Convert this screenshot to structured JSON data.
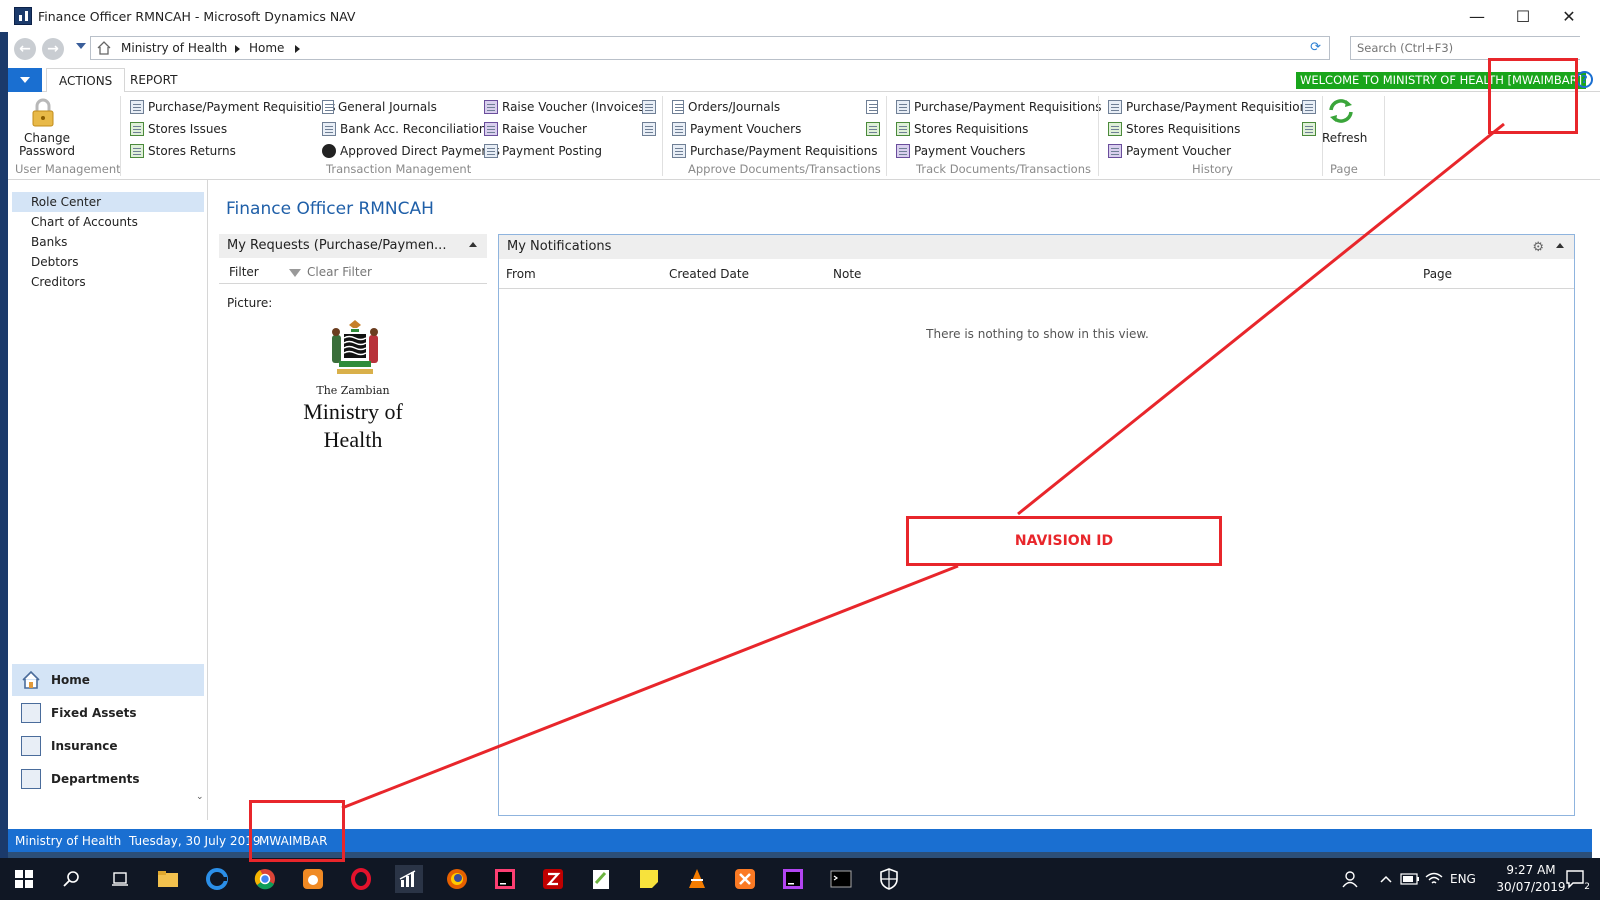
{
  "window": {
    "title": "Finance Officer RMNCAH - Microsoft Dynamics NAV",
    "minimize": "—",
    "maximize": "☐",
    "close": "✕"
  },
  "address": {
    "crumbs": [
      "Ministry of Health",
      "Home"
    ],
    "search_placeholder": "Search (Ctrl+F3)"
  },
  "ribbon_tabs": {
    "actions": "ACTIONS",
    "report": "REPORT",
    "welcome": "WELCOME TO MINISTRY OF HEALTH [MWAIMBAR]",
    "help": "?"
  },
  "ribbon": {
    "user_management": {
      "label": "User Management",
      "change_password": "Change Password"
    },
    "transaction_management": {
      "label": "Transaction Management",
      "col1": [
        "Purchase/Payment Requisitions",
        "Stores Issues",
        "Stores Returns"
      ],
      "col2": [
        "General Journals",
        "Bank Acc. Reconciliations",
        "Approved Direct Payments"
      ],
      "col3": [
        "Raise Voucher (Invoices)",
        "Raise Voucher",
        "Payment Posting"
      ]
    },
    "approve": {
      "label": "Approve Documents/Transactions",
      "items": [
        "Orders/Journals",
        "Payment Vouchers",
        "Purchase/Payment Requisitions"
      ]
    },
    "track": {
      "label": "Track  Documents/Transactions",
      "items": [
        "Purchase/Payment Requisitions",
        "Stores Requisitions",
        "Payment Vouchers"
      ]
    },
    "history": {
      "label": "History",
      "items": [
        "Purchase/Payment Requisitions",
        "Stores Requisitions",
        "Payment Voucher"
      ]
    },
    "page": {
      "label": "Page",
      "refresh": "Refresh"
    }
  },
  "navigation": {
    "items": [
      "Role Center",
      "Chart of Accounts",
      "Banks",
      "Debtors",
      "Creditors"
    ],
    "selected": "Role Center",
    "departments": [
      "Home",
      "Fixed Assets",
      "Insurance",
      "Departments"
    ],
    "more": "⌄"
  },
  "main": {
    "page_title": "Finance Officer RMNCAH",
    "requests": {
      "title": "My Requests (Purchase/Paymen...",
      "filter": "Filter",
      "clear_filter": "Clear Filter",
      "picture_label": "Picture:",
      "logo_line1": "The Zambian",
      "logo_line2": "Ministry of",
      "logo_line3": "Health"
    },
    "notifications": {
      "title": "My Notifications",
      "columns": [
        "From",
        "Created Date",
        "Note",
        "Page"
      ],
      "empty": "There is nothing to show in this view."
    }
  },
  "status_bar": {
    "company": "Ministry of Health",
    "date": "Tuesday, 30 July 2019",
    "user": "MWAIMBAR"
  },
  "annotation": {
    "label": "NAVISION ID",
    "color": "#e8262b"
  },
  "taskbar": {
    "language": "ENG",
    "time": "9:27 AM",
    "date": "30/07/2019",
    "notifications_count": "2"
  },
  "colors": {
    "accent": "#1a6fd1",
    "welcome_bg": "#19a51b",
    "title_blue": "#1f5fa8",
    "taskbar": "#101724"
  }
}
